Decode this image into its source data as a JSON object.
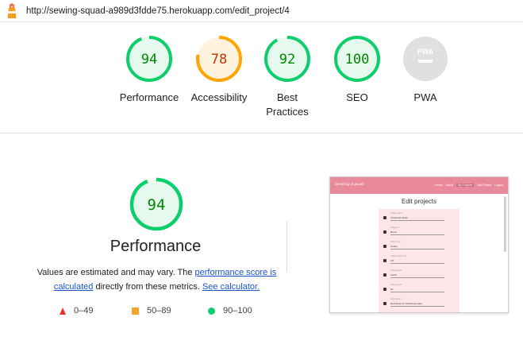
{
  "url_bar": {
    "url": "http://sewing-squad-a989d3fdde75.herokuapp.com/edit_project/4",
    "logo_icon": "lighthouse-icon"
  },
  "summary": {
    "performance": {
      "score": "94",
      "label": "Performance",
      "color": "#0cce6b",
      "text_color": "#008800",
      "fill": 0.94
    },
    "accessibility": {
      "score": "78",
      "label": "Accessibility",
      "color": "#ffa400",
      "text_color": "#c33300",
      "fill": 0.78
    },
    "best_practices": {
      "score": "92",
      "label": "Best Practices",
      "color": "#0cce6b",
      "text_color": "#008800",
      "fill": 0.92
    },
    "seo": {
      "score": "100",
      "label": "SEO",
      "color": "#0cce6b",
      "text_color": "#008800",
      "fill": 1.0
    },
    "pwa": {
      "badge": "PWA",
      "label": "PWA",
      "color": "#e0e0e0"
    }
  },
  "detail": {
    "score": "94",
    "title": "Performance",
    "desc_prefix": "Values are estimated and may vary. The ",
    "desc_link1": "performance score is calculated",
    "desc_middle": " directly from these metrics. ",
    "desc_link2": "See calculator."
  },
  "legend": {
    "fail": "0–49",
    "average": "50–89",
    "pass": "90–100"
  },
  "thumbnail": {
    "brand": "Sewing Squad",
    "nav_links": [
      "Home",
      "About",
      "My Projects",
      "Add Project",
      "Logout"
    ],
    "heading": "Edit projects",
    "rows": [
      {
        "label": "Project name",
        "value": "Christmas dress"
      },
      {
        "label": "Category*",
        "value": "Dress"
      },
      {
        "label": "Fabric type",
        "value": "Cotton"
      },
      {
        "label": "Fabric length (m)",
        "value": "2.5"
      },
      {
        "label": "Date started",
        "value": "12/10"
      },
      {
        "label": "Hours spent",
        "value": "10"
      },
      {
        "label": "Description",
        "value": "Red dress for Christmas party."
      }
    ]
  }
}
